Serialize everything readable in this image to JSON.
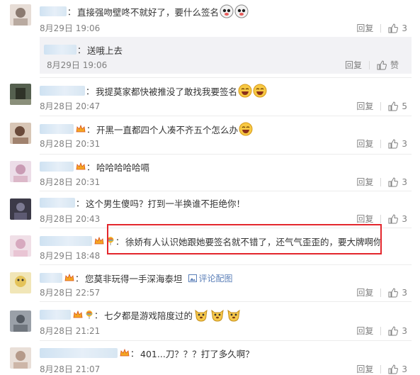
{
  "comments": [
    {
      "text": "直接强吻壁咚不就好了，要什么签名",
      "date": "8月29日 19:06",
      "reply": "回复",
      "likes": "3"
    },
    {
      "text": "我提莫家都快被推没了敢找我要签名",
      "date": "8月28日 20:47",
      "reply": "回复",
      "likes": "5"
    },
    {
      "text": "开黑一直都四个人凑不齐五个怎么办",
      "date": "8月28日 20:31",
      "reply": "回复",
      "likes": "3"
    },
    {
      "text": "哈哈哈哈哈嗝",
      "date": "8月28日 20:31",
      "reply": "回复",
      "likes": "3"
    },
    {
      "text": "这个男生傻吗？打到一半换谁不拒绝你！",
      "date": "8月28日 20:43",
      "reply": "回复",
      "likes": "3"
    },
    {
      "text": "徐娇有人认识她跟她要签名就不错了，还气气歪歪的，要大牌啊你",
      "date": "8月29日 18:48",
      "reply": "回复",
      "likes": "3"
    },
    {
      "text": "您莫非玩得一手深海泰坦",
      "pic_link": "评论配图",
      "date": "8月28日 22:57",
      "reply": "回复",
      "likes": "3"
    },
    {
      "text": "七夕都是游戏陪度过的",
      "date": "8月28日 21:21",
      "reply": "回复",
      "likes": "3"
    },
    {
      "text": "401...刀？？？打了多久啊？",
      "date": "8月28日 21:07",
      "reply": "回复",
      "likes": "3"
    }
  ],
  "sub_reply": {
    "text": "送哦上去",
    "date": "8月29日 19:06",
    "reply": "回复",
    "like_label": "赞"
  },
  "colors": {
    "highlight_border": "#e3262c",
    "link": "#5b7fb8",
    "meta_gray": "#808080"
  }
}
